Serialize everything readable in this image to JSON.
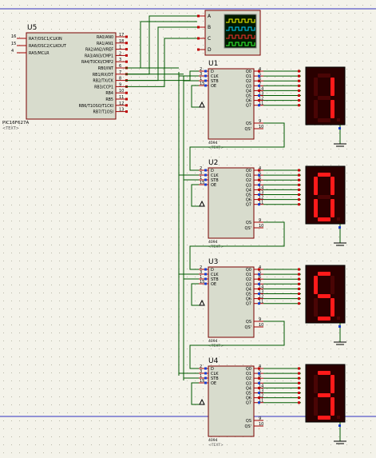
{
  "colors": {
    "background": "#f4f3ea",
    "grid_dot": "#b8b8a8",
    "chip_fill": "#d8dccd",
    "chip_border": "#7a0000",
    "wire": "#005a00",
    "pin": "#a00000",
    "display_bg": "#2a0000",
    "segment_on": "#ff1a1a",
    "segment_off": "#4a0505",
    "rail": "#3030c0",
    "osc_screen": "#001a00"
  },
  "mcu": {
    "name": "U5",
    "part": "PIC16F627A",
    "text_hint": "<TEXT>",
    "left_pins": [
      {
        "num": "16",
        "label": "RA7/OSC1/CLKIN"
      },
      {
        "num": "15",
        "label": "RA6/OSC2/CLKOUT"
      },
      {
        "num": "4",
        "label": "RA5/MCLR"
      }
    ],
    "right_pins": [
      {
        "num": "17",
        "label": "RA0/AN0"
      },
      {
        "num": "18",
        "label": "RA1/AN1"
      },
      {
        "num": "1",
        "label": "RA2/AN2/VREF"
      },
      {
        "num": "2",
        "label": "RA3/AN3/CMP1"
      },
      {
        "num": "3",
        "label": "RA4/T0CKI/CMP2"
      },
      {
        "num": "6",
        "label": "RB0/INT"
      },
      {
        "num": "7",
        "label": "RB1/RX/DT"
      },
      {
        "num": "8",
        "label": "RB2/TX/CK"
      },
      {
        "num": "9",
        "label": "RB3/CCP1"
      },
      {
        "num": "10",
        "label": "RB4"
      },
      {
        "num": "11",
        "label": "RB5"
      },
      {
        "num": "12",
        "label": "RB6/T1OSO/T1CKI"
      },
      {
        "num": "13",
        "label": "RB7/T1OSI"
      }
    ]
  },
  "scope": {
    "channels": [
      "A",
      "B",
      "C",
      "D"
    ]
  },
  "registers": [
    {
      "name": "U1",
      "part": "4094",
      "text_hint": "<TEXT>",
      "digit": "1"
    },
    {
      "name": "U2",
      "part": "4094",
      "text_hint": "<TEXT>",
      "digit": "0"
    },
    {
      "name": "U3",
      "part": "4094",
      "text_hint": "<TEXT>",
      "digit": "5"
    },
    {
      "name": "U4",
      "part": "4094",
      "text_hint": "<TEXT>",
      "digit": "3"
    }
  ],
  "register_pins": {
    "left": [
      {
        "num": "2",
        "label": "D"
      },
      {
        "num": "3",
        "label": "CLK"
      },
      {
        "num": "1",
        "label": "STB"
      },
      {
        "num": "15",
        "label": "OE"
      }
    ],
    "right": [
      {
        "num": "4",
        "label": "Q0"
      },
      {
        "num": "5",
        "label": "Q1"
      },
      {
        "num": "6",
        "label": "Q2"
      },
      {
        "num": "7",
        "label": "Q3"
      },
      {
        "num": "14",
        "label": "Q4"
      },
      {
        "num": "13",
        "label": "Q5"
      },
      {
        "num": "12",
        "label": "Q6"
      },
      {
        "num": "11",
        "label": "Q7"
      }
    ],
    "serial": [
      {
        "num": "9",
        "label": "QS"
      },
      {
        "num": "10",
        "label": "QS'"
      }
    ]
  }
}
